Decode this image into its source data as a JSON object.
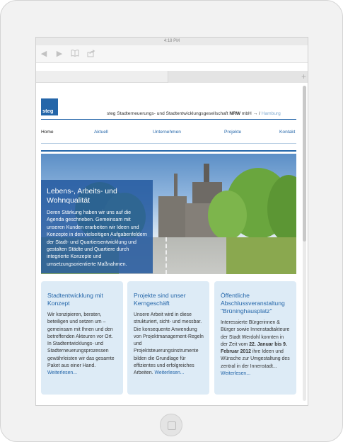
{
  "statusbar": {
    "time": "4:18 PM"
  },
  "toolbar": {
    "icons": [
      "back-arrow-icon",
      "forward-arrow-icon",
      "bookmarks-icon",
      "share-icon"
    ],
    "new_tab": "+"
  },
  "site": {
    "logo": "steg",
    "tagline_pre": "steg Stadterneuerungs- und Stadtentwicklungsgesellschaft ",
    "tagline_bold": "NRW",
    "tagline_post": " mbH ",
    "tagline_arrow": "→ /",
    "tagline_link": "Hamburg"
  },
  "nav": [
    "Home",
    "Aktuell",
    "Unternehmen",
    "Projekte",
    "Kontakt"
  ],
  "hero": {
    "title": "Lebens-, Arbeits- und Wohnqualität",
    "text": "Deren Stärkung haben wir uns auf die Agenda geschrieben. Gemeinsam mit unseren Kunden erarbeiten wir Ideen und Konzepte in den vielseitigen Aufgabenfeldern der Stadt- und Quartiersentwicklung und gestalten Städte und Quartiere durch integrierte Konzepte und umsetzungsorientierte Maßnahmen."
  },
  "cards": [
    {
      "title": "Stadtentwicklung mit Konzept",
      "text": "Wir konzipieren, beraten, beteiligen und setzen um – gemeinsam mit Ihnen und den betreffenden Akteuren vor Ort. In Stadtentwicklungs- und Stadterneuerungsprozessen gewährleisten wir das gesamte Paket aus einer Hand.",
      "link": "Weiterlesen..."
    },
    {
      "title": "Projekte sind unser Kerngeschäft",
      "text": "Unsere Arbeit wird in diese strukturiert, sicht- und messbar. Die konsequente Anwendung von Projektmanagement-Regeln und Projektsteuerungsinstrumente bilden die Grundlage für effizientes und erfolgreiches Arbeiten.",
      "link": "Weiterlesen..."
    },
    {
      "title": "Öffentliche Abschlussveranstaltung \"Brüninghausplatz\"",
      "text_pre": "Interessierte Bürgerinnen & Bürger sowie Innenstadtakteure der Stadt Werdohl konnten in der Zeit vom ",
      "text_bold1": "22. Januar bis 9. Februar 2012",
      "text_post": " ihre Ideen und Wünsche zur Umgestaltung des zentral in der Innenstadt...",
      "link": "Weiterlesen..."
    }
  ],
  "colors": {
    "brand_blue": "#2466a9",
    "card_bg": "#ddebf6",
    "hero_box": "#245aa0"
  }
}
